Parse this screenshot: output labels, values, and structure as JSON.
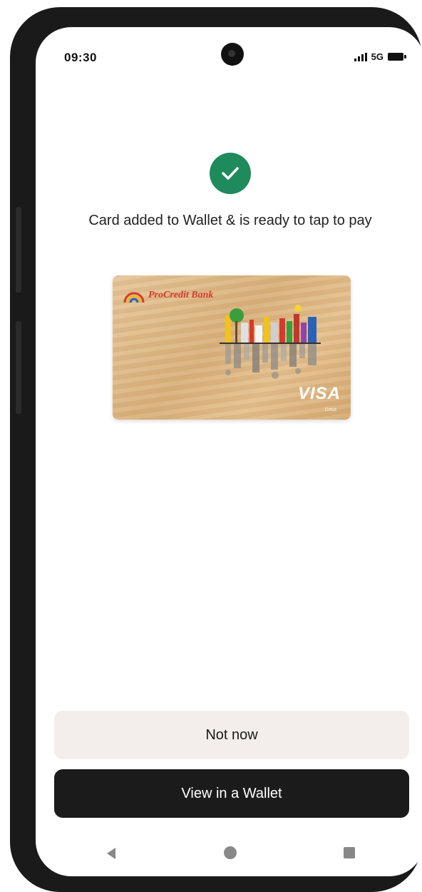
{
  "status_bar": {
    "time": "09:30",
    "network": "5G",
    "icons": [
      "signal-icon",
      "battery-icon"
    ]
  },
  "success": {
    "icon": "checkmark-icon",
    "color": "#1f8a5b",
    "message": "Card added to Wallet & is ready to tap to pay"
  },
  "card": {
    "bank_name": "ProCredit Bank",
    "network": "VISA",
    "network_sub": "Debit"
  },
  "actions": {
    "not_now": "Not now",
    "view_wallet": "View in a Wallet"
  },
  "navigation": {
    "items": [
      "back-icon",
      "home-icon",
      "recents-icon"
    ]
  }
}
